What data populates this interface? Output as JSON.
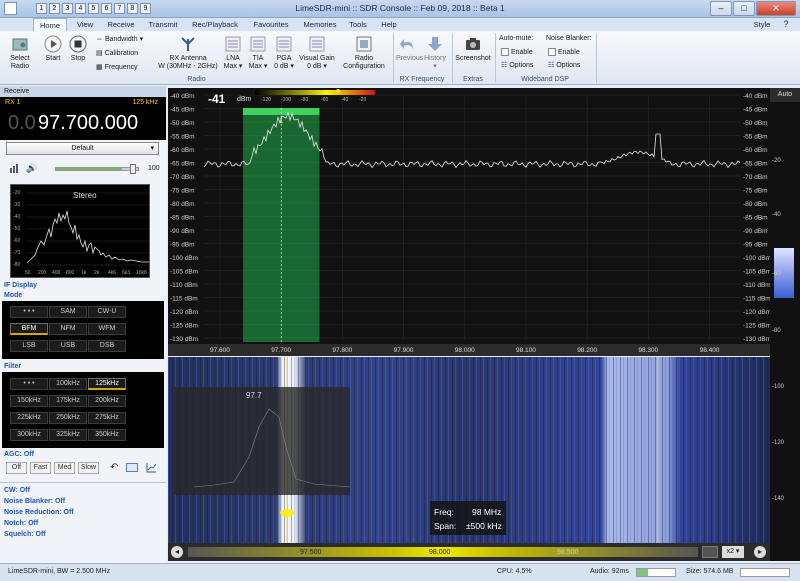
{
  "window": {
    "title": "LimeSDR-mini :: SDR Console :: Feb 09, 2018 :: Beta 1",
    "style_label": "Style"
  },
  "menu": {
    "tabs": [
      "Home",
      "View",
      "Receive",
      "Transmit",
      "Rec/Playback",
      "Favourites",
      "Memories",
      "Tools",
      "Help"
    ],
    "active": "Home"
  },
  "ribbon": {
    "select_radio": "Select Radio",
    "start": "Start",
    "stop": "Stop",
    "bandwidth": "Bandwidth",
    "calibration": "Calibration",
    "frequency": "Frequency",
    "rx_antenna_line1": "RX Antenna",
    "rx_antenna_line2": "W (30MHz - 2GHz)",
    "lna_line1": "LNA",
    "lna_line2": "Max",
    "tia_line1": "TIA",
    "tia_line2": "Max",
    "pga_line1": "PGA",
    "pga_line2": "0 dB",
    "visual_gain_line1": "Visual Gain",
    "visual_gain_line2": "0 dB",
    "radio_config_line1": "Radio",
    "radio_config_line2": "Configuration",
    "group_radio": "Radio",
    "previous": "Previous",
    "history": "History",
    "group_rx_frequency": "RX Frequency",
    "screenshot": "Screenshot",
    "group_extras": "Extras",
    "auto_mute": "Auto-mute:",
    "noise_blanker": "Noise Blanker:",
    "enable": "Enable",
    "options": "Options",
    "group_wideband_dsp": "Wideband DSP"
  },
  "receive": {
    "header": "Receive",
    "rx_label": "RX 1",
    "bandwidth": "125 kHz",
    "freq_dim": "0.0",
    "freq_main": "97.700.000",
    "preset": "Default",
    "volume": "100",
    "stereo": "Stereo",
    "audio_y": [
      "-20",
      "-30",
      "-40",
      "-50",
      "-60",
      "-70",
      "-80"
    ],
    "audio_x": [
      "50",
      "200",
      "400",
      "800",
      "1k",
      "2k",
      "4k6",
      "6k3",
      "10k8"
    ],
    "if_display": "IF Display",
    "mode_title": "Mode",
    "modes": [
      "• • •",
      "SAM",
      "CW-U",
      "BFM",
      "NFM",
      "WFM",
      "LSB",
      "USB",
      "DSB"
    ],
    "mode_selected": "BFM",
    "filter_title": "Filter",
    "filters": [
      "• • •",
      "100kHz",
      "125kHz",
      "150kHz",
      "175kHz",
      "200kHz",
      "225kHz",
      "250kHz",
      "275kHz",
      "300kHz",
      "325kHz",
      "350kHz"
    ],
    "filter_selected": "125kHz",
    "agc_title": "AGC: Off",
    "agc_buttons": [
      "Off",
      "Fast",
      "Med",
      "Slow"
    ],
    "dsp": [
      "CW: Off",
      "Noise Blanker: Off",
      "Noise Reduction: Off",
      "Notch: Off",
      "Squelch: Off"
    ]
  },
  "spectrum": {
    "level": "-41",
    "level_unit": "dBm",
    "meter_ticks": [
      "-120",
      "-100",
      "-80",
      "-60",
      "-40",
      "-20"
    ],
    "db_labels": [
      "-40 dBm",
      "-45 dBm",
      "-50 dBm",
      "-55 dBm",
      "-60 dBm",
      "-65 dBm",
      "-70 dBm",
      "-75 dBm",
      "-80 dBm",
      "-85 dBm",
      "-90 dBm",
      "-95 dBm",
      "-100 dBm",
      "-105 dBm",
      "-110 dBm",
      "-115 dBm",
      "-120 dBm",
      "-125 dBm",
      "-130 dBm"
    ],
    "freq_labels": [
      "97.600",
      "97.700",
      "97.800",
      "97.900",
      "98.000",
      "98.100",
      "98.200",
      "98.300",
      "98.400"
    ],
    "marker": "1",
    "colors": {
      "passband": "#22b14c",
      "trace": "#e6e6e6",
      "meter_peak": "#ffe600"
    }
  },
  "waterfall": {
    "overlay_freq": "97.7",
    "info_freq_label": "Freq:",
    "info_freq_value": "98 MHz",
    "info_span_label": "Span:",
    "info_span_value": "±500 kHz",
    "scroll_labels": [
      "97.500",
      "98.000",
      "98.500"
    ],
    "zoom": "x2"
  },
  "rightbar": {
    "auto": "Auto",
    "ticks": [
      "-20",
      "-40",
      "-60",
      "-80",
      "-100",
      "-120",
      "-140"
    ]
  },
  "status": {
    "device": "LimeSDR-mini, BW = 2.500 MHz",
    "cpu": "CPU: 4.5%",
    "audio": "Audio: 92ms",
    "size": "Size: 574.6 MB"
  }
}
